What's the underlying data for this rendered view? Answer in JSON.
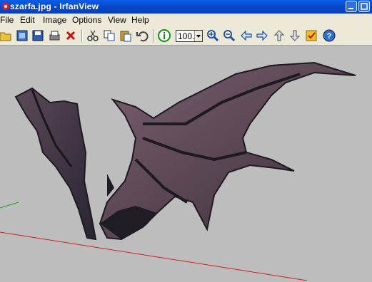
{
  "window": {
    "title": "szarfa.jpg - IrfanView"
  },
  "menu": {
    "items": [
      "File",
      "Edit",
      "Image",
      "Options",
      "View",
      "Help"
    ]
  },
  "toolbar": {
    "zoom_value": "100."
  },
  "viewer": {
    "image_description_icon": "dragon-wings-render"
  },
  "colors": {
    "titlebar": "#0848c8",
    "menubar": "#ece9d8",
    "viewer_background": "#bdbdbd"
  }
}
